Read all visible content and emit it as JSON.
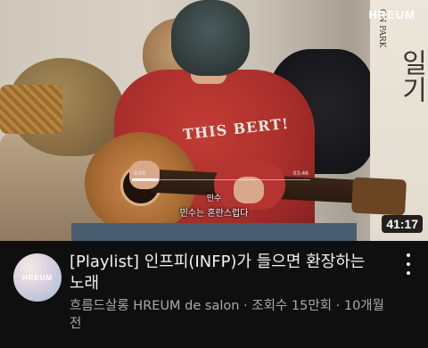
{
  "thumbnail": {
    "brand": "HREUM",
    "poster_text_1": "ON PARK",
    "poster_text_2": "일기",
    "sweater_print": "THIS BERT!",
    "mini_player": {
      "current": "0:00",
      "total": "03:46",
      "progress": 0.15
    },
    "caption_line1": "민수",
    "caption_line2": "민수는 혼란스럽다",
    "duration": "41:17"
  },
  "channel": {
    "avatar_text": "HREUM"
  },
  "video": {
    "title_line1": "[Playlist] 인프피(INFP)가 들으면 환장하는",
    "title_line2": "노래",
    "meta_line1": "흐름드살롱 HREUM de salon · 조회수 15만회 · 10개월",
    "meta_line2": "전"
  },
  "icons": {
    "more": "more-vert-icon"
  }
}
